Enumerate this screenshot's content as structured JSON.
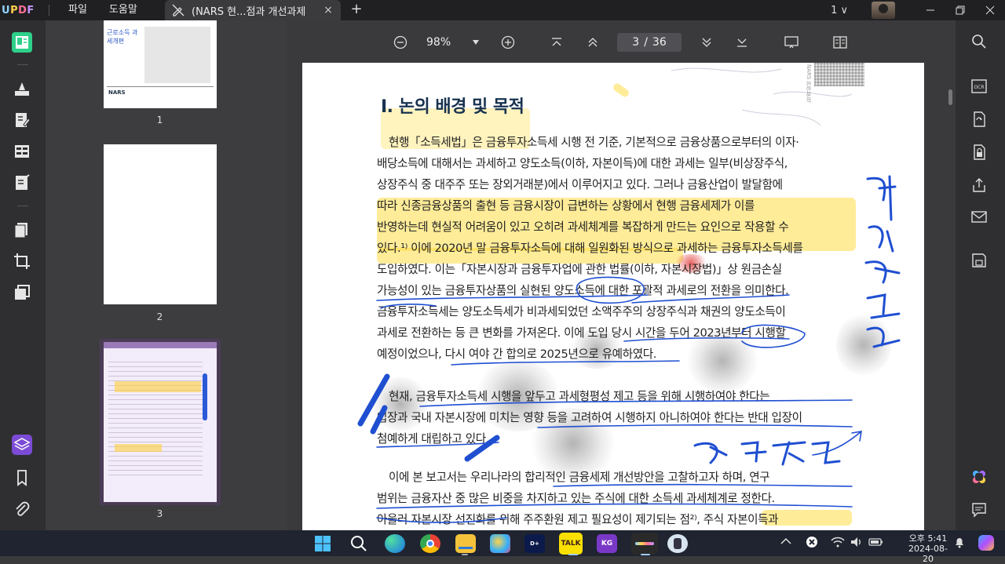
{
  "app": {
    "logo_text": "UPDF",
    "menu": [
      "파일",
      "도움말"
    ],
    "tab_title": "(NARS 현...점과 개선과제",
    "tab_close": "×",
    "new_tab": "+",
    "window_count": "1 ∨"
  },
  "thumbnails": {
    "pages": [
      {
        "label": "1",
        "title": "근로소득 과세개편"
      },
      {
        "label": "2"
      },
      {
        "label": "3",
        "selected": true
      }
    ]
  },
  "toolbar": {
    "zoom": "98%",
    "current_page": "3",
    "page_sep": "/",
    "total_pages": "36"
  },
  "document": {
    "heading": "Ⅰ. 논의 배경 및 목적",
    "lines": [
      "현행「소득세법」은 금융투자소득세 시행 전 기준, 기본적으로 금융상품으로부터의 이자·",
      "배당소득에 대해서는 과세하고 양도소득(이하, 자본이득)에 대한 과세는 일부(비상장주식,",
      "상장주식 중 대주주 또는 장외거래분)에서 이루어지고 있다. 그러나 금융산업이 발달함에",
      "따라 신종금융상품의 출현 등 금융시장이 급변하는 상황에서 현행 금융세제가 이를",
      "반영하는데 현실적 어려움이 있고 오히려 과세체계를 복잡하게 만드는 요인으로 작용할 수",
      "있다.¹⁾ 이에 2020년 말 금융투자소득에 대해 일원화된 방식으로 과세하는 금융투자소득세를",
      "도입하였다. 이는「자본시장과 금융투자업에 관한 법률(이하, 자본시장법)」상  원금손실",
      "가능성이 있는 금융투자상품의 실현된 양도소득에 대한 포괄적 과세로의 전환을 의미한다.",
      "금융투자소득세는 양도소득세가 비과세되었던 소액주주의 상장주식과 채권의 양도소득이",
      "과세로 전환하는 등 큰 변화를 가져온다. 이에 도입 당시 시간을 두어 2023년부터 시행할",
      "예정이었으나, 다시 여야 간 합의로 2025년으로 유예하였다.",
      "현재, 금융투자소득세 시행을 앞두고 과세형평성 제고 등을 위해 시행하여야 한다는",
      "입장과 국내 자본시장에 미치는 영향 등을 고려하여 시행하지 아니하여야 한다는 반대 입장이",
      "첨예하게 대립하고 있다.",
      "이에 본 보고서는 우리나라의 합리적인 금융세제 개선방안을 고찰하고자 하며, 연구",
      "범위는 금융자산 중 많은 비중을 차지하고 있는 주식에 대한 소득세 과세체계로 정한다.",
      "아울러 자본시장 선진화를 위해 주주환원 제고 필요성이 제기되는 점²⁾, 주식 자본이득과"
    ],
    "side_text": "NARS 현안분석",
    "handwriting_right": "과세일원화",
    "handwriting_bottom": "정치적논리"
  },
  "taskbar": {
    "apps": [
      "start",
      "search",
      "edge",
      "chrome",
      "explorer",
      "paint",
      "disney-plus",
      "kakaotalk",
      "kg",
      "updf",
      "other"
    ],
    "clock_time": "오후 5:41",
    "clock_date": "2024-08-20"
  },
  "colors": {
    "titlebar": "#202022",
    "panel": "#3d3d40",
    "rail": "#2f2f31",
    "highlight": "#ffd84a",
    "pen_blue": "#1f4fd1",
    "heading": "#17324f",
    "selected_thumb": "#4b3c55"
  }
}
